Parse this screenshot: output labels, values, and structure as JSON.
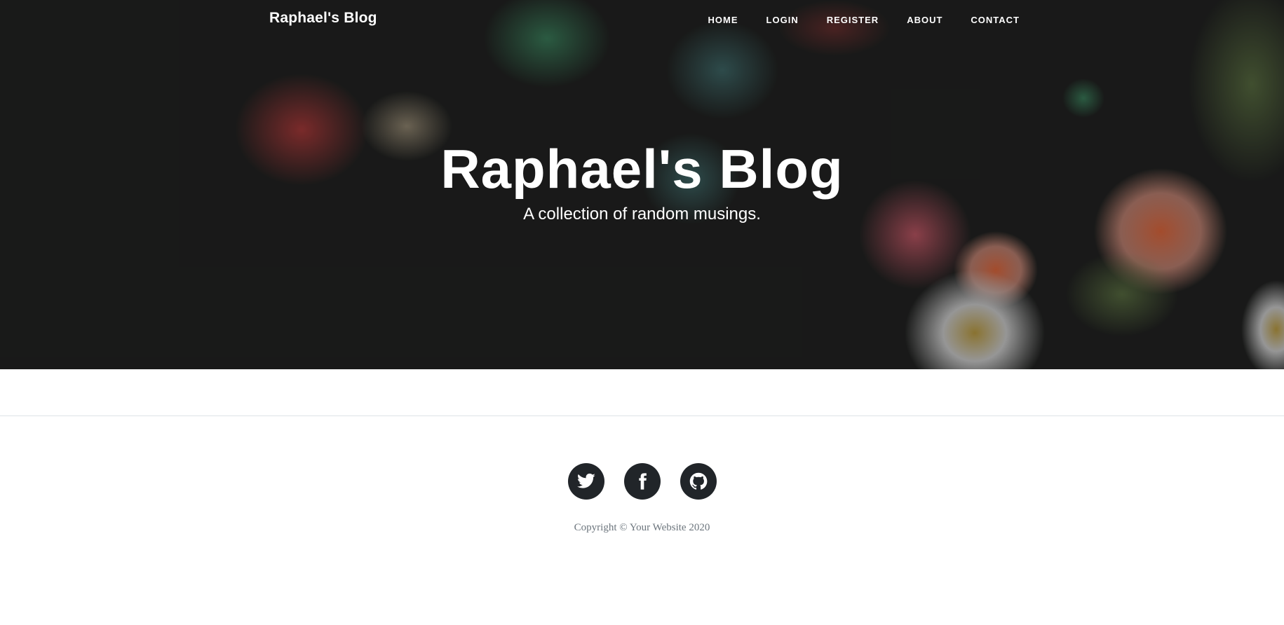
{
  "nav": {
    "brand": "Raphael's Blog",
    "links": [
      "HOME",
      "LOGIN",
      "REGISTER",
      "ABOUT",
      "CONTACT"
    ]
  },
  "hero": {
    "title": "Raphael's Blog",
    "subtitle": "A collection of random musings.",
    "background": "dark sea anemone photograph"
  },
  "footer": {
    "social_icons": [
      "twitter-icon",
      "facebook-icon",
      "github-icon"
    ],
    "copyright": "Copyright © Your Website 2020"
  },
  "colors": {
    "hero_dark": "#1f1f1f",
    "social_circle": "#212529",
    "copyright_text": "#6c757d",
    "divider": "#dee2e6"
  }
}
